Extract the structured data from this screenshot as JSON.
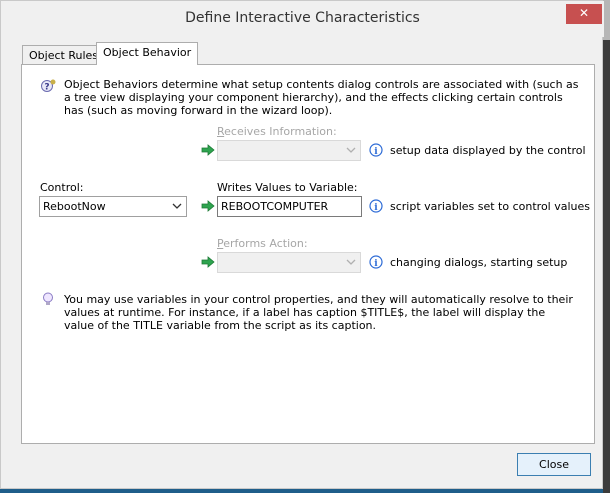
{
  "window": {
    "title": "Define Interactive Characteristics",
    "close_glyph": "✕"
  },
  "tabs": [
    {
      "label": "Object Rules",
      "active": false
    },
    {
      "label": "Object Behavior",
      "active": true
    }
  ],
  "intro": "Object Behaviors determine what setup contents dialog controls are associated with (such as a tree view displaying your component hierarchy), and the effects clicking certain controls has (such as moving forward in the wizard loop).",
  "receives": {
    "label": "Receives Information:",
    "value": "",
    "description": "setup data displayed by the control"
  },
  "control": {
    "label": "Control:",
    "value": "RebootNow"
  },
  "writes": {
    "label": "Writes Values to Variable:",
    "value": "REBOOTCOMPUTER",
    "description": "script variables set to control values"
  },
  "performs": {
    "label": "Performs Action:",
    "value": "",
    "description": "changing dialogs, starting setup"
  },
  "tip": "You may use variables in your control properties, and they will automatically resolve to their values at runtime. For instance, if a label has caption $TITLE$, the label will display the value of the TITLE variable from the script as its caption.",
  "close_button": "Close",
  "icons": {
    "help": "help-question-icon",
    "arrow": "green-arrow-icon",
    "info": "info-icon",
    "tip": "lightbulb-icon"
  },
  "colors": {
    "accent_green": "#2ea44f",
    "info_blue": "#2d6bd6",
    "close_red": "#c75050"
  }
}
